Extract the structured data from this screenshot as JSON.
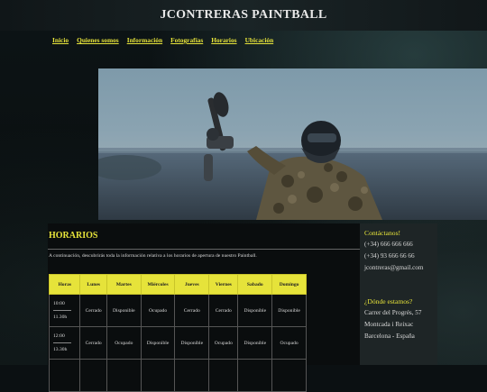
{
  "site_title": "JCONTRERAS PAINTBALL",
  "nav": [
    "Inicio",
    "Quienes somos",
    "Información",
    "Fotografías",
    "Horarios",
    "Ubicación"
  ],
  "section_title": "HORARIOS",
  "intro_text": "A continuación, descubrirás toda la información relativa a los horarios de apertura de nuestro Paintball.",
  "table": {
    "headers": [
      "Horas",
      "Lunes",
      "Martes",
      "Miércoles",
      "Jueves",
      "Viernes",
      "Sabado",
      "Domingo"
    ],
    "rows": [
      {
        "time_start": "10:00",
        "time_end": "11.30h",
        "cells": [
          "Cerrado",
          "Disponible",
          "Ocupado",
          "Cerrado",
          "Cerrado",
          "Disponible",
          "Disponible"
        ]
      },
      {
        "time_start": "12:00",
        "time_end": "13.30h",
        "cells": [
          "Cerrado",
          "Ocupado",
          "Disponible",
          "Disponible",
          "Ocupado",
          "Disponible",
          "Ocupado"
        ]
      }
    ]
  },
  "sidebar": {
    "contact_title": "Contáctanos!",
    "phone1": "(+34) 666 666 666",
    "phone2": "(+34) 93 666 66 66",
    "email": "jcontreras@gmail.com",
    "where_title": "¿Dónde estamos?",
    "address1": "Carrer del Progrés, 57",
    "address2": "Montcada i Reixac",
    "address3": "Barcelona - España"
  },
  "colors": {
    "accent": "#e6e33a",
    "background": "#0b1012",
    "sidebar": "#1e2526"
  }
}
